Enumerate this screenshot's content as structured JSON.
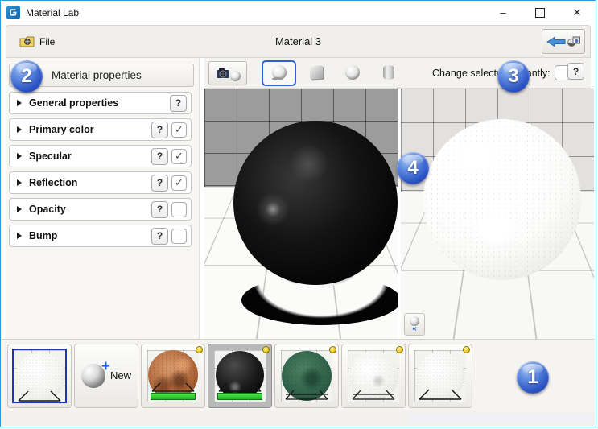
{
  "window": {
    "title": "Material Lab",
    "controls": {
      "minimize": "–",
      "close": "✕"
    }
  },
  "toolbar": {
    "file_label": "File",
    "material_title": "Material 3"
  },
  "left_panel": {
    "header": "Material properties",
    "help_label": "?",
    "check_glyph": "✓",
    "sections": [
      {
        "label": "General properties",
        "has_checkbox": false,
        "checked": false
      },
      {
        "label": "Primary color",
        "has_checkbox": true,
        "checked": true
      },
      {
        "label": "Specular",
        "has_checkbox": true,
        "checked": true
      },
      {
        "label": "Reflection",
        "has_checkbox": true,
        "checked": true
      },
      {
        "label": "Opacity",
        "has_checkbox": true,
        "checked": false
      },
      {
        "label": "Bump",
        "has_checkbox": true,
        "checked": false
      }
    ]
  },
  "preview_toolbar": {
    "change_selected_label": "Change selected instantly:",
    "change_selected_checked": false,
    "help_label": "?",
    "shapes": [
      "sphere-on-stand",
      "cube",
      "sphere",
      "cylinder"
    ],
    "selected_shape": "sphere-on-stand"
  },
  "badges": {
    "thumbnails_area": "1",
    "properties_area": "2",
    "preview_options_area": "3",
    "preview_area": "4"
  },
  "thumbnails": {
    "new_label": "New",
    "items": [
      {
        "name": "default-white-speckled",
        "selected_border": true,
        "modified_dot": false,
        "progress": false
      },
      {
        "name": "new-material-button"
      },
      {
        "name": "copper",
        "modified_dot": true,
        "progress": true,
        "selected": false
      },
      {
        "name": "black",
        "modified_dot": true,
        "progress": true,
        "selected": true
      },
      {
        "name": "green-marble",
        "modified_dot": true,
        "progress": false,
        "selected": false
      },
      {
        "name": "white-marble",
        "modified_dot": true,
        "progress": false,
        "selected": false
      },
      {
        "name": "white-speckled",
        "modified_dot": true,
        "progress": false,
        "selected": false
      }
    ]
  },
  "colors": {
    "window_border": "#2b9cd8",
    "accent_blue": "#2f5fd0",
    "progress_green": "#2fd42f",
    "badge_blue": "#2c55c4"
  }
}
